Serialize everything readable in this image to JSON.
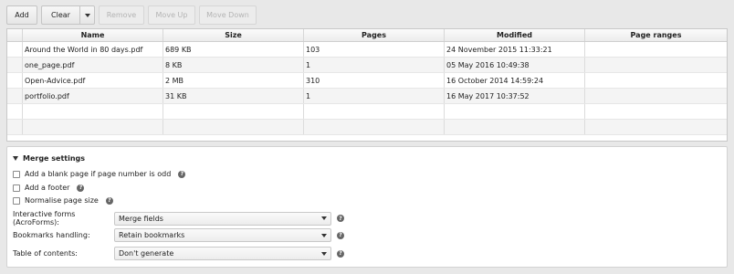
{
  "toolbar": {
    "add": "Add",
    "clear": "Clear",
    "remove": "Remove",
    "move_up": "Move Up",
    "move_down": "Move Down"
  },
  "table": {
    "columns": [
      "",
      "Name",
      "Size",
      "Pages",
      "Modified",
      "Page ranges"
    ],
    "rows": [
      {
        "name": "Around the World in 80 days.pdf",
        "size": "689 KB",
        "pages": "103",
        "modified": "24 November 2015 11:33:21",
        "ranges": ""
      },
      {
        "name": "one_page.pdf",
        "size": "8 KB",
        "pages": "1",
        "modified": "05 May 2016 10:49:38",
        "ranges": ""
      },
      {
        "name": "Open-Advice.pdf",
        "size": "2 MB",
        "pages": "310",
        "modified": "16 October 2014 14:59:24",
        "ranges": ""
      },
      {
        "name": "portfolio.pdf",
        "size": "31 KB",
        "pages": "1",
        "modified": "16 May 2017 10:37:52",
        "ranges": ""
      }
    ]
  },
  "settings": {
    "title": "Merge settings",
    "checks": {
      "blank_page": "Add a blank page if page number is odd",
      "footer": "Add a footer",
      "normalise": "Normalise page size"
    },
    "interactive_forms": {
      "label": "Interactive forms (AcroForms):",
      "value": "Merge fields"
    },
    "bookmarks": {
      "label": "Bookmarks handling:",
      "value": "Retain bookmarks"
    },
    "toc": {
      "label": "Table of contents:",
      "value": "Don't generate"
    },
    "help_glyph": "?"
  }
}
